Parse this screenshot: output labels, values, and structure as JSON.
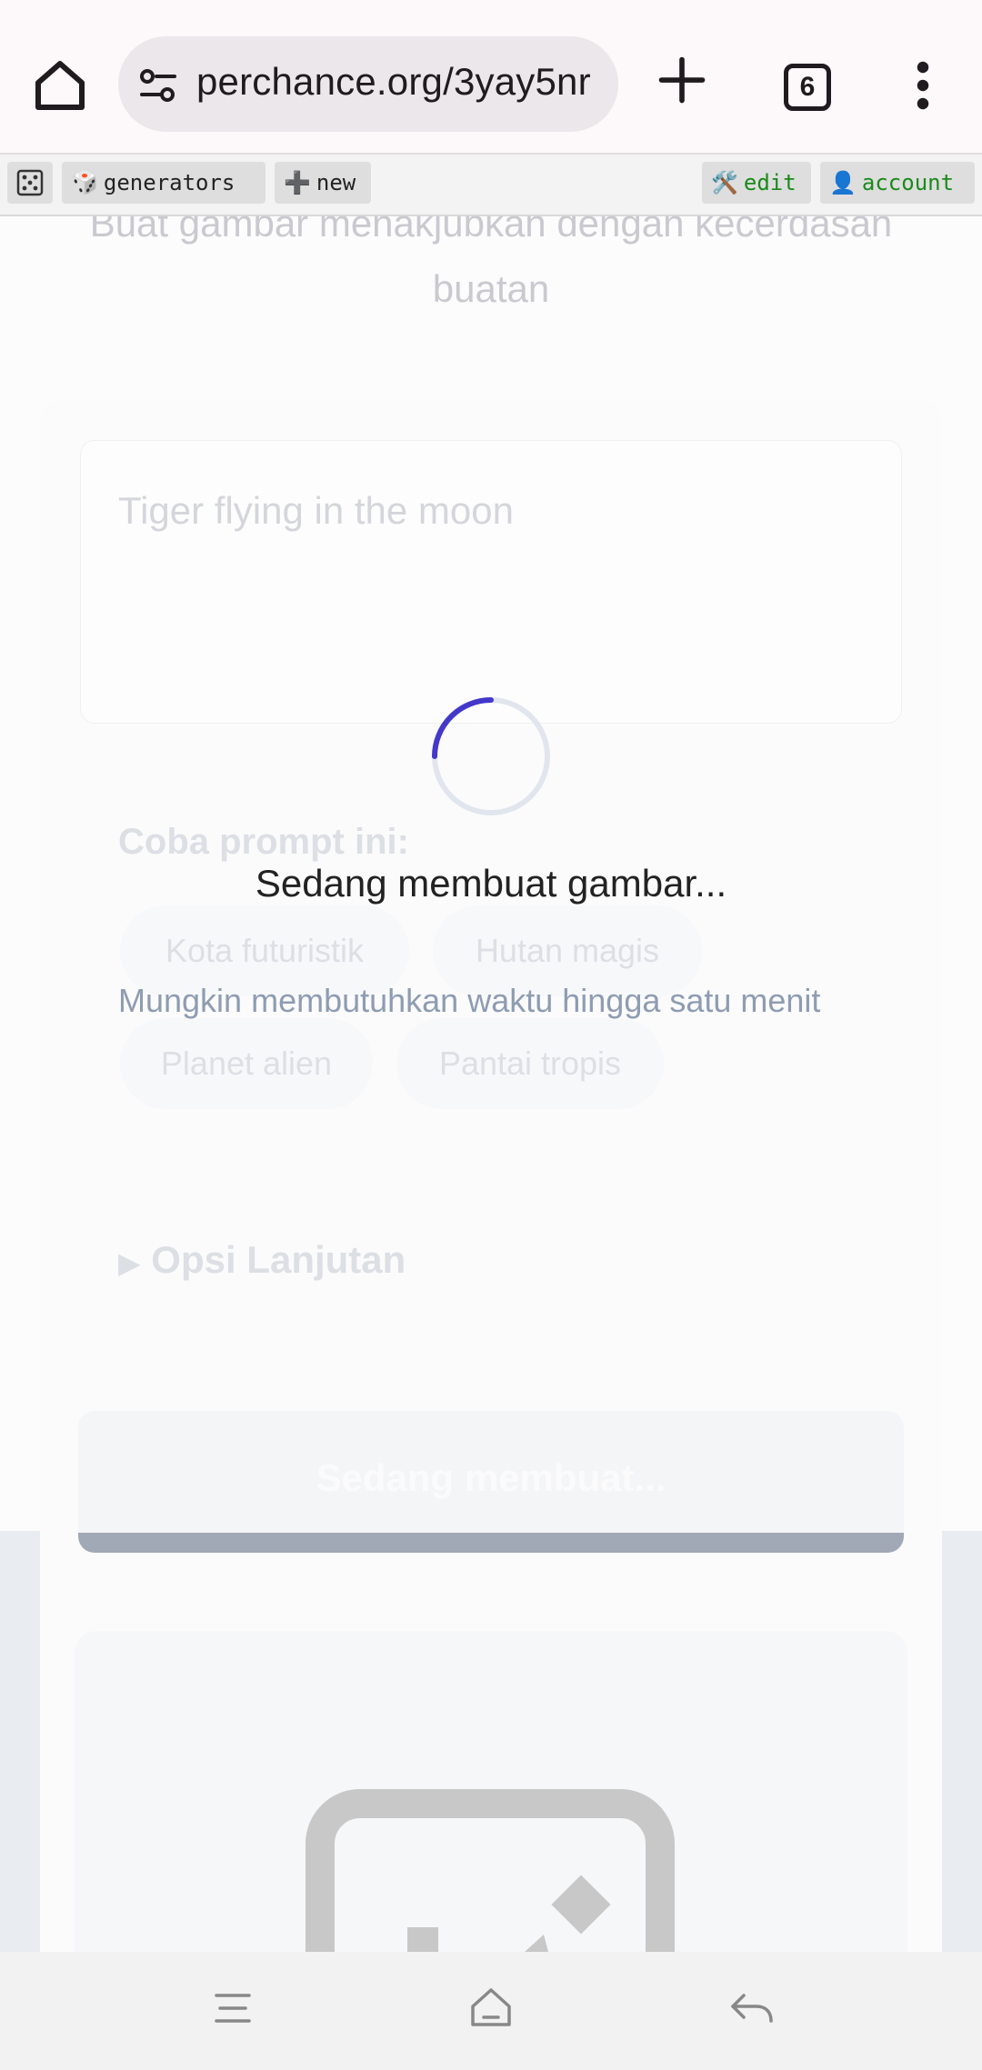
{
  "browser": {
    "url": "perchance.org/3yay5nr",
    "tab_count": "6",
    "icons": [
      "home-icon",
      "site-settings-icon",
      "new-tab-plus-icon",
      "tab-switcher-icon",
      "more-vert-icon"
    ]
  },
  "perchance_bar": {
    "generators_label": "generators",
    "new_label": "new",
    "edit_label": "edit",
    "account_label": "account"
  },
  "page": {
    "subtitle": "Buat gambar menakjubkan dengan kecerdasan buatan",
    "prompt_placeholder": "Tiger flying in the moon",
    "loading_text": "Sedang membuat gambar...",
    "hint_text": "Mungkin membutuhkan waktu hingga satu menit",
    "try_title": "Coba prompt ini:",
    "chips": [
      "Kota futuristik",
      "Hutan magis",
      "Planet alien",
      "Pantai tropis"
    ],
    "advanced_label": "Opsi Lanjutan",
    "generate_button_label": "Sedang membuat..."
  },
  "colors": {
    "spinner_accent": "#4338ca",
    "hint": "#8e9cb2",
    "edit_green": "#1a8a1a"
  },
  "navbar": {
    "icons": [
      "recents-icon",
      "home-outline-icon",
      "back-icon"
    ]
  }
}
